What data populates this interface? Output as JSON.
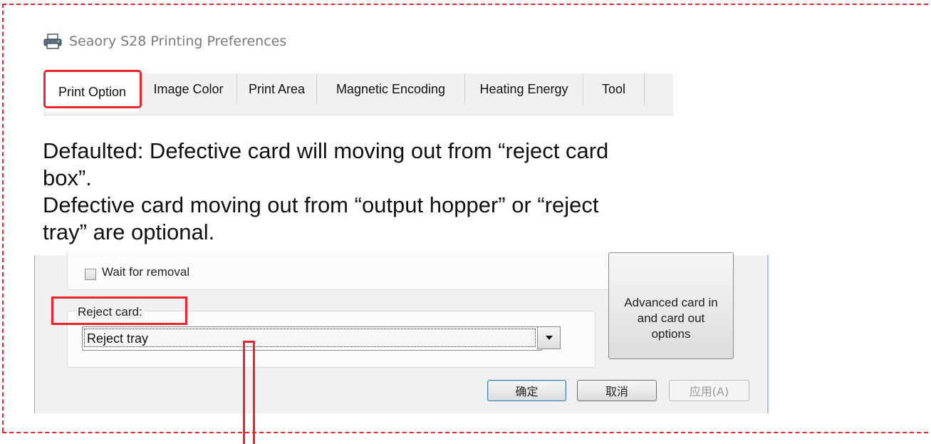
{
  "window": {
    "title": "Seaory S28 Printing Preferences",
    "icon": "printer-icon"
  },
  "tabs": [
    {
      "label": "Print Option",
      "active": true
    },
    {
      "label": "Image Color",
      "active": false
    },
    {
      "label": "Print Area",
      "active": false
    },
    {
      "label": "Magnetic Encoding",
      "active": false
    },
    {
      "label": "Heating Energy",
      "active": false
    },
    {
      "label": "Tool",
      "active": false
    }
  ],
  "description": {
    "line1": "Defaulted: Defective card will moving out from “reject card box”.",
    "line2": "Defective card moving out from “output hopper” or “reject tray” are optional."
  },
  "dialog": {
    "wait_for_removal": {
      "label": "Wait for removal",
      "checked": false
    },
    "reject_card": {
      "label": "Reject card:",
      "selected": "Reject tray"
    },
    "advanced_button": "Advanced card in and card out options",
    "buttons": {
      "ok": "确定",
      "cancel": "取消",
      "apply": "应用(A)"
    }
  },
  "colors": {
    "highlight": "#e8262b",
    "dialog_bg": "#f0f0f0"
  }
}
